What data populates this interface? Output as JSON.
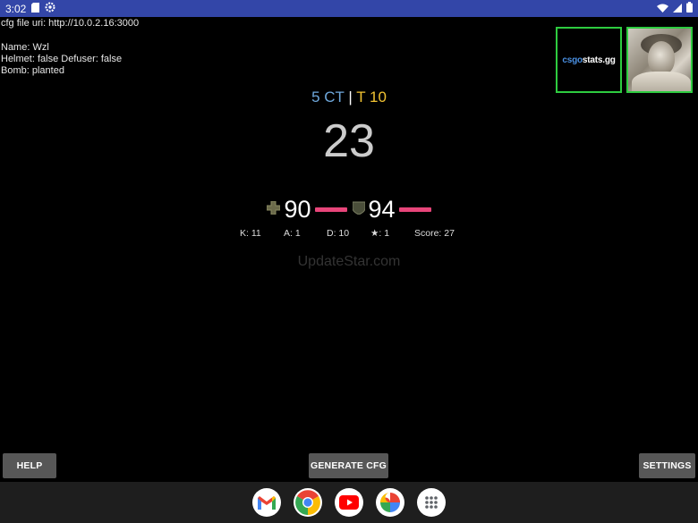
{
  "status_bar": {
    "time": "3:02",
    "left_icons": [
      "sd-card-icon",
      "settings-gear-icon"
    ],
    "right_icons": [
      "wifi-icon",
      "signal-icon",
      "battery-icon"
    ],
    "color": "#3346a8"
  },
  "info": {
    "cfg_uri": "cfg file uri: http://10.0.2.16:3000",
    "name": "Name: Wzl",
    "helmet_defuser": "Helmet: false Defuser: false",
    "bomb": "Bomb: planted"
  },
  "thumbnails": {
    "logo_part1": "csgo",
    "logo_part2": "stats.gg"
  },
  "score": {
    "ct": "5 CT",
    "sep": "|",
    "t": "T 10",
    "ct_color": "#6fa8dc",
    "t_color": "#f1c232"
  },
  "timer": "23",
  "vitals": {
    "health": "90",
    "armor": "94",
    "bar_color": "#e8457a"
  },
  "stats": {
    "kills": "K: 11",
    "assists": "A: 1",
    "deaths": "D: 10",
    "mvp": "★: 1",
    "score": "Score: 27"
  },
  "watermark": "UpdateStar.com",
  "buttons": {
    "help": "HELP",
    "generate": "GENERATE CFG",
    "settings": "SETTINGS"
  },
  "dock": {
    "apps": [
      "gmail-icon",
      "chrome-icon",
      "youtube-icon",
      "photos-icon",
      "app-drawer-icon"
    ]
  }
}
